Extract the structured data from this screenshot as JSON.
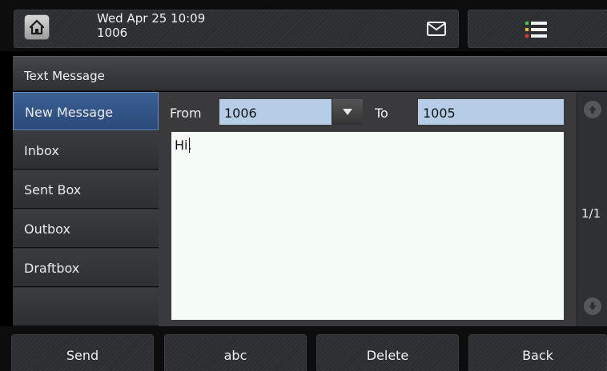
{
  "status": {
    "datetime": "Wed Apr 25 10:09",
    "account": "1006",
    "icons": [
      "home-icon",
      "message-icon",
      "menu-icon"
    ]
  },
  "screen": {
    "title": "Text Message"
  },
  "sidebar": {
    "items": [
      {
        "label": "New Message",
        "active": true
      },
      {
        "label": "Inbox"
      },
      {
        "label": "Sent Box"
      },
      {
        "label": "Outbox"
      },
      {
        "label": "Draftbox"
      },
      {
        "label": ""
      }
    ]
  },
  "compose": {
    "from_label": "From",
    "from_value": "1006",
    "to_label": "To",
    "to_value": "1005",
    "body": "Hi."
  },
  "pager": {
    "indicator": "1/1"
  },
  "softkeys": [
    "Send",
    "abc",
    "Delete",
    "Back"
  ],
  "colors": {
    "accent": "#2f5086",
    "field": "#b5cde6",
    "body_bg": "#f5fbf7"
  }
}
